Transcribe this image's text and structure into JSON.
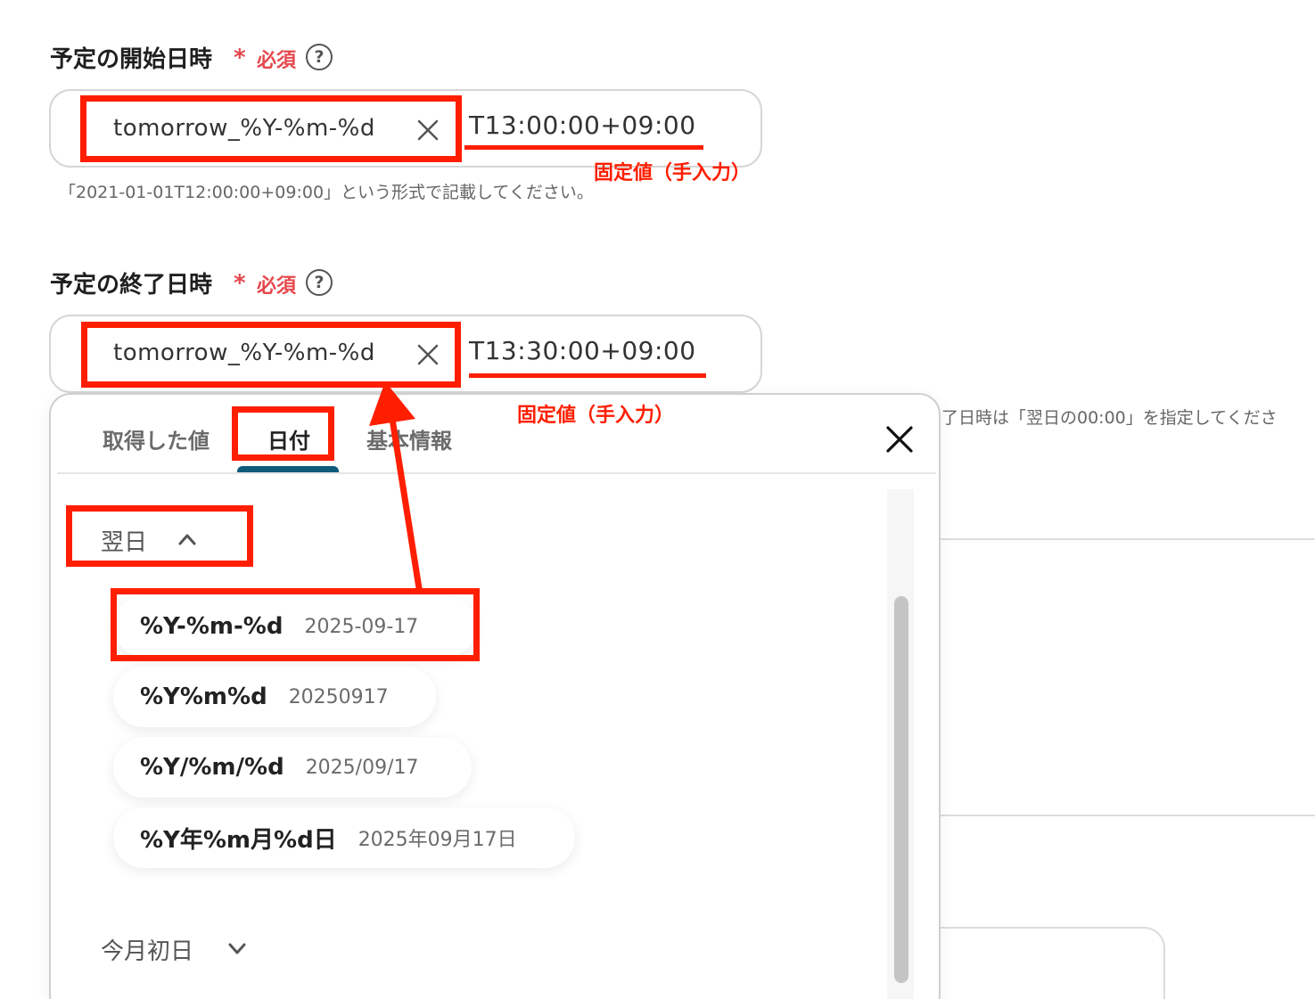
{
  "start_field": {
    "label": "予定の開始日時",
    "required_star": "*",
    "required_text": "必須",
    "help": "?",
    "chip": "tomorrow_%Y-%m-%d",
    "fixed_value": "T13:00:00+09:00",
    "hint": "「2021-01-01T12:00:00+09:00」という形式で記載してください。",
    "annotation": "固定値（手入力）"
  },
  "end_field": {
    "label": "予定の終了日時",
    "required_star": "*",
    "required_text": "必須",
    "help": "?",
    "chip": "tomorrow_%Y-%m-%d",
    "fixed_value": "T13:30:00+09:00",
    "hint_partial": "了日時は「翌日の00:00」を指定してくださ",
    "annotation": "固定値（手入力）"
  },
  "popup": {
    "tabs": [
      {
        "label": "取得した値",
        "active": false
      },
      {
        "label": "日付",
        "active": true
      },
      {
        "label": "基本情報",
        "active": false
      }
    ],
    "close_icon": "close-icon",
    "groups": [
      {
        "label": "翌日",
        "expanded": true,
        "chevron": "chevron-up-icon",
        "options": [
          {
            "format": "%Y-%m-%d",
            "example": "2025-09-17"
          },
          {
            "format": "%Y%m%d",
            "example": "20250917"
          },
          {
            "format": "%Y/%m/%d",
            "example": "2025/09/17"
          },
          {
            "format": "%Y年%m月%d日",
            "example": "2025年09月17日"
          }
        ]
      },
      {
        "label": "今月初日",
        "expanded": false,
        "chevron": "chevron-down-icon"
      }
    ]
  },
  "colors": {
    "annotation_red": "#ff1e00",
    "required_red": "#e5484d",
    "tab_accent": "#0e5a79"
  }
}
